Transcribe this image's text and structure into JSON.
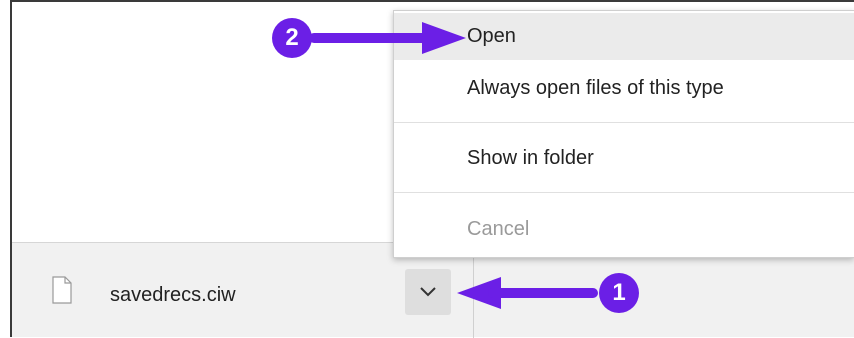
{
  "download_bar": {
    "file_name": "savedrecs.ciw",
    "file_icon": "file-icon",
    "menu_toggle_icon": "chevron-down-icon"
  },
  "context_menu": {
    "items": [
      {
        "label": "Open",
        "state": "highlighted"
      },
      {
        "label": "Always open files of this type",
        "state": "normal"
      },
      {
        "label": "Show in folder",
        "state": "normal"
      },
      {
        "label": "Cancel",
        "state": "disabled"
      }
    ]
  },
  "annotations": {
    "step_1": "1",
    "step_2": "2",
    "color": "#6b1fe6"
  }
}
